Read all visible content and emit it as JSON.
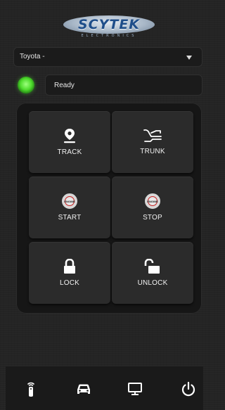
{
  "brand": {
    "name": "SCYTEK",
    "sub": "ELECTRONICS"
  },
  "vehicle_select": {
    "value": "Toyota -"
  },
  "status": {
    "text": "Ready",
    "led_color": "#4edc2c"
  },
  "controls": [
    {
      "id": "track",
      "label": "TRACK",
      "icon": "location-pin-icon"
    },
    {
      "id": "trunk",
      "label": "TRUNK",
      "icon": "trunk-icon"
    },
    {
      "id": "start",
      "label": "START",
      "icon": "engine-start-icon"
    },
    {
      "id": "stop",
      "label": "STOP",
      "icon": "engine-stop-icon"
    },
    {
      "id": "lock",
      "label": "LOCK",
      "icon": "lock-icon"
    },
    {
      "id": "unlock",
      "label": "UNLOCK",
      "icon": "unlock-icon"
    }
  ],
  "engine_badge": "ENGINE",
  "tabbar": [
    {
      "id": "remote",
      "icon": "remote-icon"
    },
    {
      "id": "car",
      "icon": "car-icon"
    },
    {
      "id": "screen",
      "icon": "monitor-icon"
    },
    {
      "id": "power",
      "icon": "power-icon"
    }
  ],
  "colors": {
    "background": "#242424",
    "button": "#2b2b2b",
    "panel": "#161616",
    "engine_ring": "#c82020",
    "brand_blue": "#1f4e8a"
  }
}
